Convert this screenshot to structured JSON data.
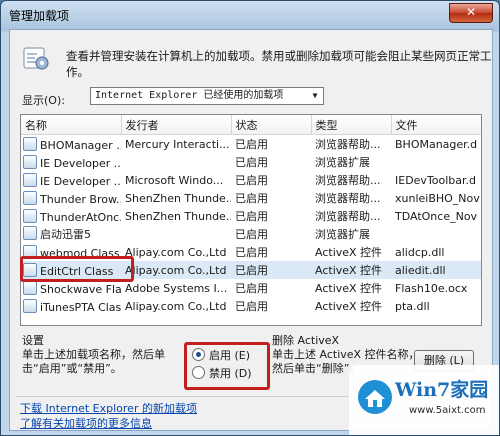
{
  "window": {
    "title": "管理加载项",
    "close_glyph": "✕"
  },
  "header": {
    "description": "查看并管理安装在计算机上的加载项。禁用或删除加载项可能会阻止某些网页正常工作。"
  },
  "show": {
    "label": "显示(O):",
    "selected": "Internet Explorer 已经使用的加载项"
  },
  "table": {
    "columns": [
      "名称",
      "发行者",
      "状态",
      "类型",
      "文件"
    ],
    "rows": [
      [
        "BHOManager ...",
        "Mercury Interacti...",
        "已启用",
        "浏览器帮助...",
        "BHOManager.d"
      ],
      [
        "IE Developer ...",
        "",
        "已启用",
        "浏览器扩展",
        ""
      ],
      [
        "IE Developer ...",
        "Microsoft Windo...",
        "已启用",
        "浏览器帮助...",
        "IEDevToolbar.d"
      ],
      [
        "Thunder Brow...",
        "ShenZhen Thunde...",
        "已启用",
        "浏览器帮助...",
        "xunleiBHO_Nov"
      ],
      [
        "ThunderAtOnc...",
        "ShenZhen Thunde...",
        "已启用",
        "浏览器帮助...",
        "TDAtOnce_Nov"
      ],
      [
        "启动迅雷5",
        "",
        "已启用",
        "浏览器扩展",
        ""
      ],
      [
        "webmod Class",
        "Alipay.com Co.,Ltd",
        "已启用",
        "ActiveX 控件",
        "alidcp.dll"
      ],
      [
        "EditCtrl Class",
        "Alipay.com Co.,Ltd",
        "已启用",
        "ActiveX 控件",
        "aliedit.dll"
      ],
      [
        "Shockwave Fla...",
        "Adobe Systems I...",
        "已启用",
        "ActiveX 控件",
        "Flash10e.ocx"
      ],
      [
        "iTunesPTA Class",
        "Alipay.com Co.,Ltd",
        "已启用",
        "ActiveX 控件",
        "pta.dll"
      ]
    ],
    "selected_row": 7
  },
  "settings": {
    "title": "设置",
    "hint": "单击上述加载项名称，然后单击“启用”或“禁用”。",
    "enable_label": "启用 (E)",
    "disable_label": "禁用 (D)",
    "selected": "enable"
  },
  "remove": {
    "title": "删除 ActiveX",
    "hint": "单击上述 ActiveX 控件名称，然后单击“删除”。",
    "button_label": "删除 (L)"
  },
  "links": {
    "download": "下载 Internet Explorer 的新加载项",
    "learn_more": "了解有关加载项的更多信息"
  },
  "watermark": {
    "title": "Win7家园",
    "url": "www.5aixt.com"
  }
}
